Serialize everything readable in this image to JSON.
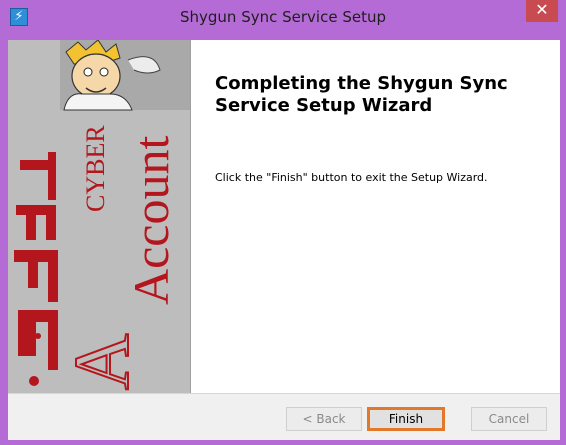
{
  "window": {
    "title": "Shygun Sync Service Setup",
    "close_glyph": "✕",
    "app_icon_glyph": "⚡"
  },
  "banner": {
    "brand_primary": "Account",
    "brand_secondary": "CYBER",
    "brand_letter": "A",
    "arabic_text": "سایبر"
  },
  "main": {
    "heading": "Completing the Shygun Sync Service Setup Wizard",
    "instruction": "Click the \"Finish\" button to exit the Setup Wizard."
  },
  "buttons": {
    "back": "< Back",
    "finish": "Finish",
    "cancel": "Cancel"
  },
  "colors": {
    "window_frame": "#b56bd6",
    "close_button": "#c74b50",
    "finish_highlight": "#e2782a",
    "brand_red": "#b3161c",
    "banner_bg": "#bdbdbd"
  }
}
